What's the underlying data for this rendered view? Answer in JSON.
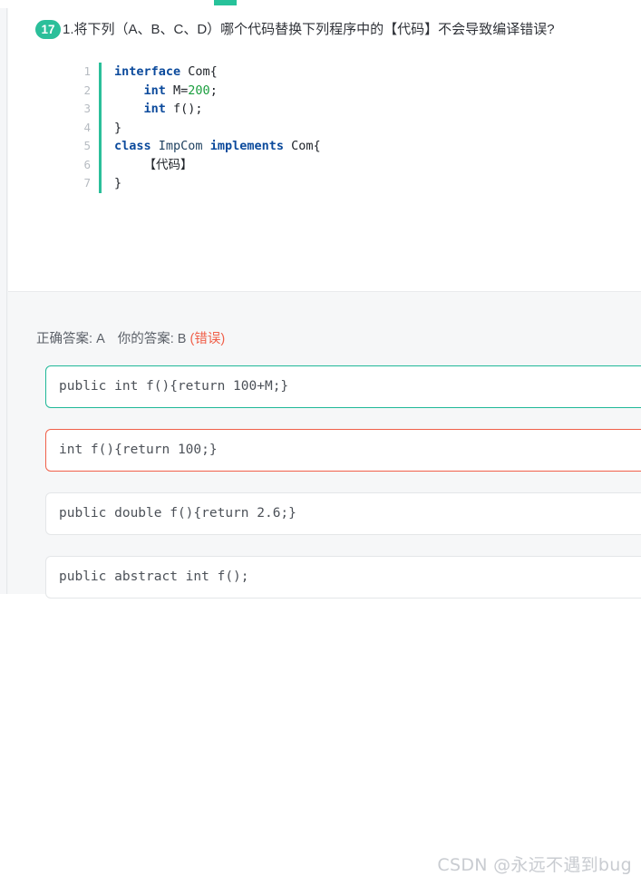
{
  "top_bar": {
    "tab_indicator_color": "#27c29a"
  },
  "question": {
    "badge_number": "17",
    "badge_color": "#2bbf9a",
    "text": "1.将下列（A、B、C、D）哪个代码替换下列程序中的【代码】不会导致编译错误?",
    "code": {
      "language": "java",
      "lines": [
        {
          "no": "1",
          "tokens": [
            {
              "t": "interface ",
              "c": "kw"
            },
            {
              "t": "Com{",
              "c": "plain"
            }
          ]
        },
        {
          "no": "2",
          "tokens": [
            {
              "t": "    ",
              "c": "plain"
            },
            {
              "t": "int ",
              "c": "kw"
            },
            {
              "t": "M=",
              "c": "plain"
            },
            {
              "t": "200",
              "c": "num"
            },
            {
              "t": ";",
              "c": "plain"
            }
          ]
        },
        {
          "no": "3",
          "tokens": [
            {
              "t": "    ",
              "c": "plain"
            },
            {
              "t": "int ",
              "c": "kw"
            },
            {
              "t": "f();",
              "c": "plain"
            }
          ]
        },
        {
          "no": "4",
          "tokens": [
            {
              "t": "}",
              "c": "plain"
            }
          ]
        },
        {
          "no": "5",
          "tokens": [
            {
              "t": "class ",
              "c": "kw"
            },
            {
              "t": "ImpCom ",
              "c": "typ"
            },
            {
              "t": "implements ",
              "c": "kw"
            },
            {
              "t": "Com{",
              "c": "plain"
            }
          ]
        },
        {
          "no": "6",
          "tokens": [
            {
              "t": "    ",
              "c": "plain"
            },
            {
              "t": "【代码】",
              "c": "cjk"
            }
          ]
        },
        {
          "no": "7",
          "tokens": [
            {
              "t": "}",
              "c": "plain"
            }
          ]
        }
      ]
    }
  },
  "answer": {
    "correct_label": "正确答案:",
    "correct_value": "A",
    "your_label": "你的答案:",
    "your_value": "B",
    "result_text": "(错误)",
    "result_color": "#f0604a",
    "options": [
      {
        "key": "A",
        "text": "public int f(){return 100+M;}",
        "state": "correct",
        "border_color": "#1fb898"
      },
      {
        "key": "B",
        "text": "int f(){return 100;}",
        "state": "chosen-wrong",
        "border_color": "#f0604a"
      },
      {
        "key": "C",
        "text": "public double f(){return 2.6;}",
        "state": "normal",
        "border_color": "#e4e6e8"
      },
      {
        "key": "D",
        "text": "public abstract int f();",
        "state": "normal",
        "border_color": "#e4e6e8"
      }
    ]
  },
  "watermark": {
    "text": "CSDN @永远不遇到bug"
  }
}
